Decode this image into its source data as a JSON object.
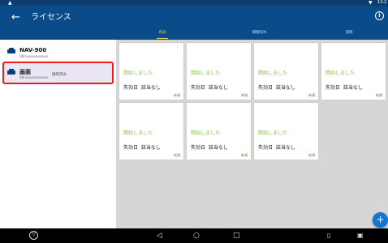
{
  "status_bar": {
    "left_icon": "android-notification-icon",
    "wifi_icon": "wifi-icon",
    "clock": "13:2"
  },
  "app_bar": {
    "back_icon": "back-arrow-icon",
    "title": "ライセンス",
    "info_icon": "info-icon"
  },
  "tabs": [
    {
      "label": "有効",
      "active": true
    },
    {
      "label": "期限切れ",
      "active": false
    },
    {
      "label": "消耗",
      "active": false
    }
  ],
  "devices": [
    {
      "name": "NAV-900",
      "sn": "SN:xxxxxxxxxxxx",
      "state": "",
      "selected": false
    },
    {
      "name": "画面",
      "sn": "SN:xxxxxxxxxxxx",
      "state": "接続済み",
      "selected": true
    }
  ],
  "cards": [
    {
      "started": "開始しました",
      "expiry_label": "失効日",
      "expiry_value": "該当なし",
      "tag": "新規",
      "menu": "⋮"
    },
    {
      "started": "開始しました",
      "expiry_label": "失効日",
      "expiry_value": "該当なし",
      "tag": "新規",
      "menu": ""
    },
    {
      "started": "開始しました",
      "expiry_label": "失効日",
      "expiry_value": "該当なし",
      "tag": "新規",
      "menu": ""
    },
    {
      "started": "開始しました",
      "expiry_label": "失効日",
      "expiry_value": "該当なし",
      "tag": "新規",
      "menu": ""
    },
    {
      "started": "開始しました",
      "expiry_label": "失効日",
      "expiry_value": "該当なし",
      "tag": "新規",
      "menu": ""
    },
    {
      "started": "開始しました",
      "expiry_label": "失効日",
      "expiry_value": "該当なし",
      "tag": "新規",
      "menu": ""
    },
    {
      "started": "開始しました",
      "expiry_label": "失効日",
      "expiry_value": "該当なし",
      "tag": "新規",
      "menu": ""
    }
  ],
  "fab": {
    "label": "+",
    "icon": "add-icon"
  },
  "nav_bar": {
    "app_icon": "trimble-app-icon",
    "back": "◁",
    "home": "○",
    "recents": "□",
    "right_icon_1": "device-icon",
    "right_icon_2": "screenshot-icon"
  },
  "colors": {
    "app_bar": "#0a4b8a",
    "status_bar": "#0c3d6e",
    "active_tab": "#e2d45a",
    "started_text": "#8bc34a",
    "highlight": "#ee1c1c",
    "fab": "#1573d6"
  }
}
